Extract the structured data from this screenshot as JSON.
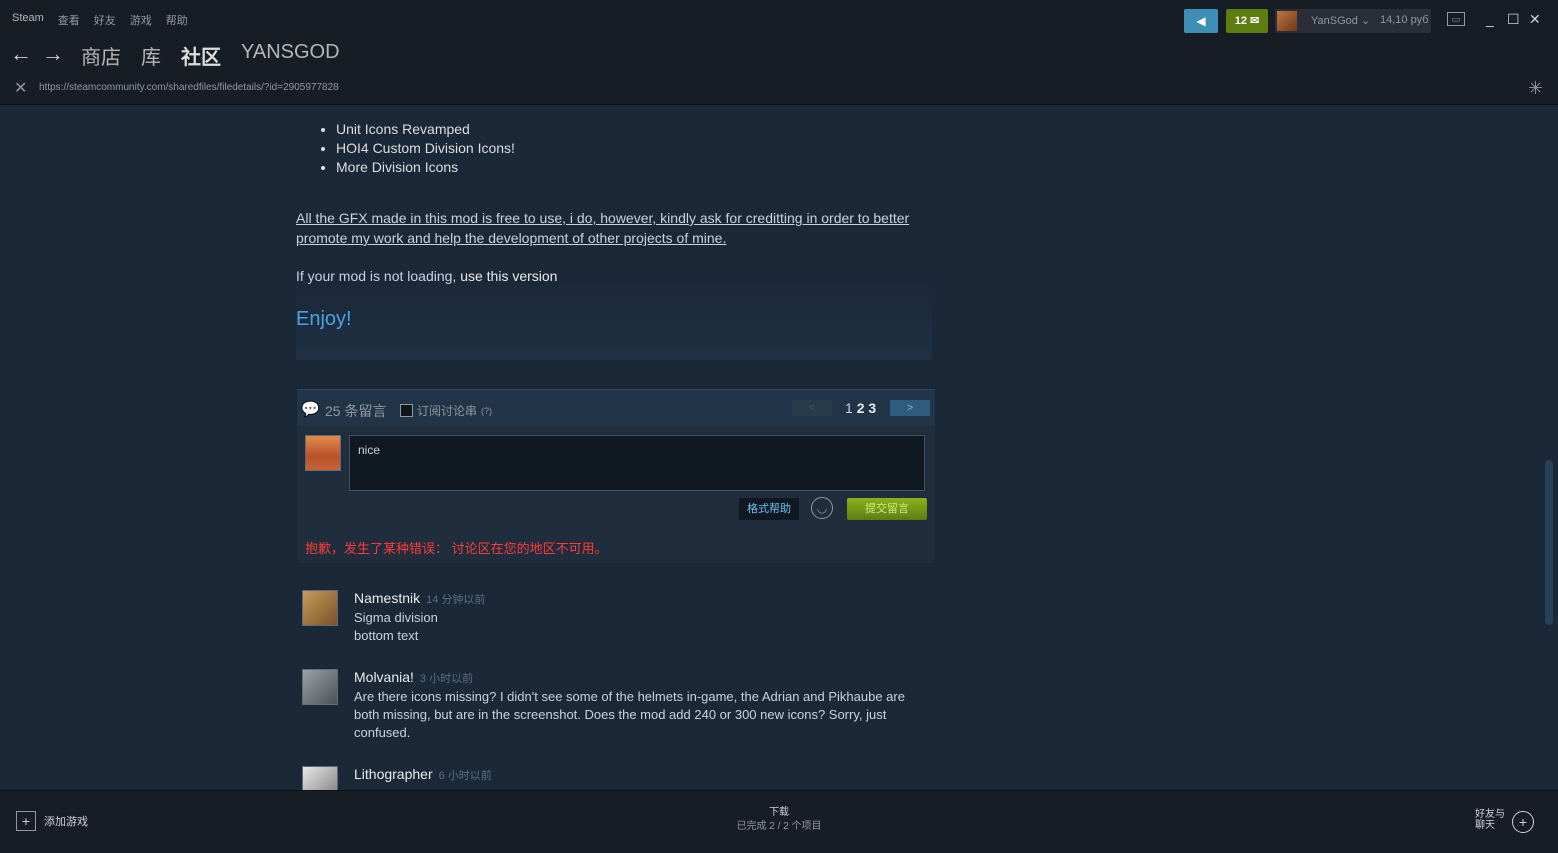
{
  "menu": [
    "Steam",
    "查看",
    "好友",
    "游戏",
    "帮助"
  ],
  "header": {
    "inbox_count": "12",
    "inbox_icon": "✉",
    "user_name": "YanSGod",
    "user_caret": "⌄",
    "balance": "14,10 руб",
    "win_controls": [
      "_",
      "☐",
      "✕"
    ]
  },
  "nav": {
    "back": "←",
    "forward": "→",
    "links": [
      "商店",
      "库",
      "社区",
      "YANSGOD"
    ]
  },
  "url": "https://steamcommunity.com/sharedfiles/filedetails/?id=2905977828",
  "description": {
    "mod_list": [
      "Unit Icons Revamped",
      "HOI4 Custom Division Icons!",
      "More Division Icons"
    ],
    "gfx_note": "All the GFX made in this mod is free to use, i do, however, kindly ask for creditting in order to better promote my work and help the development of other projects of mine.",
    "loading_prefix": "If your mod is not loading, ",
    "loading_link": "use this version",
    "enjoy": "Enjoy!"
  },
  "comments_panel": {
    "count_label": "25 条留言",
    "subscribe_label": "订阅讨论串",
    "subscribe_help": "(?)",
    "prev": "<",
    "next": ">",
    "pages": [
      "1",
      "2",
      "3"
    ],
    "input_value": "nice",
    "format_help": "格式帮助",
    "submit": "提交留言",
    "error": "抱歉，发生了某种错误： 讨论区在您的地区不可用。"
  },
  "comments": [
    {
      "author": "Namestnik",
      "time": "14 分钟以前",
      "lines": [
        "Sigma division",
        "bottom text"
      ]
    },
    {
      "author": "Molvania!",
      "time": "3 小时以前",
      "lines": [
        "Are there icons missing? I didn't see some of the helmets in-game, the Adrian and Pikhaube are both missing, but are in the screenshot. Does the mod add 240 or 300 new icons? Sorry, just confused."
      ]
    },
    {
      "author": "Lithographer",
      "time": "6 小时以前",
      "lines": []
    }
  ],
  "bottom": {
    "add_game": "添加游戏",
    "downloads_title": "下载",
    "downloads_status": "已完成 2 / 2 个项目",
    "friends_line1": "好友与",
    "friends_line2": "聊天"
  }
}
